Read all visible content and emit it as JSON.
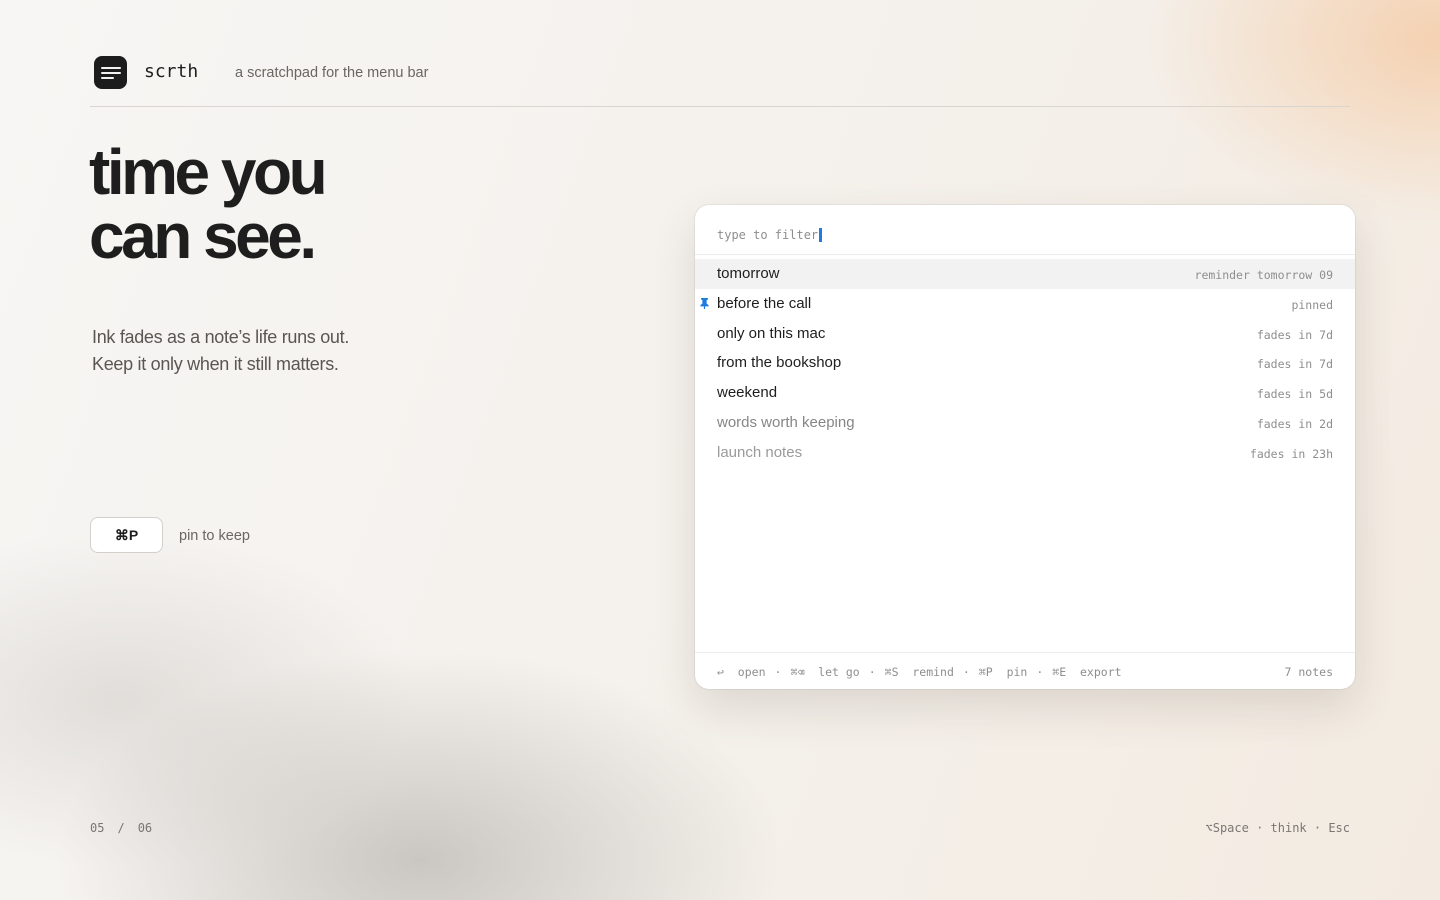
{
  "header": {
    "brand": "scrth",
    "tagline": "a scratchpad for the menu bar"
  },
  "hero": {
    "headline_line1": "time you",
    "headline_line2": "can see.",
    "sub_line1": "Ink fades as a note’s life runs out.",
    "sub_line2": "Keep it only when it still matters."
  },
  "shortcut": {
    "key": "⌘P",
    "label": "pin to keep"
  },
  "pager": {
    "current": "05",
    "sep": "/",
    "total": "06"
  },
  "hint": "⌥Space · think · Esc",
  "panel": {
    "filter_placeholder": "type to filter",
    "notes": [
      {
        "title": "tomorrow",
        "meta": "reminder tomorrow 09"
      },
      {
        "title": "before the call",
        "meta": "pinned"
      },
      {
        "title": "only on this mac",
        "meta": "fades in 7d"
      },
      {
        "title": "from the bookshop",
        "meta": "fades in 7d"
      },
      {
        "title": "weekend",
        "meta": "fades in 5d"
      },
      {
        "title": "words worth keeping",
        "meta": "fades in 2d"
      },
      {
        "title": "launch notes",
        "meta": "fades in 23h"
      }
    ],
    "footer": {
      "open_key": "↩",
      "open": "open",
      "letgo_key": "⌘⌫",
      "letgo": "let go",
      "remind_key": "⌘S",
      "remind": "remind",
      "pin_key": "⌘P",
      "pin": "pin",
      "export_key": "⌘E",
      "export": "export",
      "dot": "·",
      "count": "7 notes"
    }
  },
  "icons": {
    "logo": "notes-app-icon",
    "pin": "pin-icon"
  },
  "colors": {
    "accent": "#1e7be0",
    "ink": "#1e1e1e"
  }
}
